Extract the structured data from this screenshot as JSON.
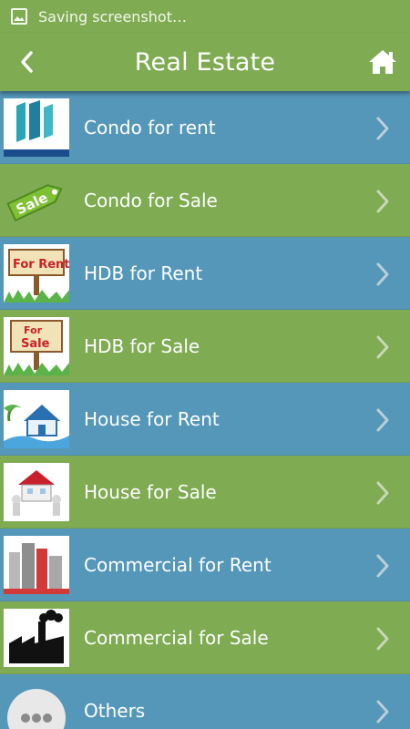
{
  "status_bar": {
    "text": "Saving screenshot…"
  },
  "app_bar": {
    "title": "Real Estate"
  },
  "colors": {
    "blue": "#5597b9",
    "green": "#7fab52"
  },
  "items": [
    {
      "label": "Condo for rent",
      "icon": "condo-building-icon"
    },
    {
      "label": "Condo for Sale",
      "icon": "sale-tag-icon"
    },
    {
      "label": "HDB for Rent",
      "icon": "for-rent-sign-icon"
    },
    {
      "label": "HDB for Sale",
      "icon": "for-sale-sign-icon"
    },
    {
      "label": "House for Rent",
      "icon": "house-icon"
    },
    {
      "label": "House for Sale",
      "icon": "house-carry-icon"
    },
    {
      "label": "Commercial for Rent",
      "icon": "office-buildings-icon"
    },
    {
      "label": "Commercial for Sale",
      "icon": "factory-icon"
    },
    {
      "label": "Others",
      "icon": "more-dots-icon"
    }
  ]
}
